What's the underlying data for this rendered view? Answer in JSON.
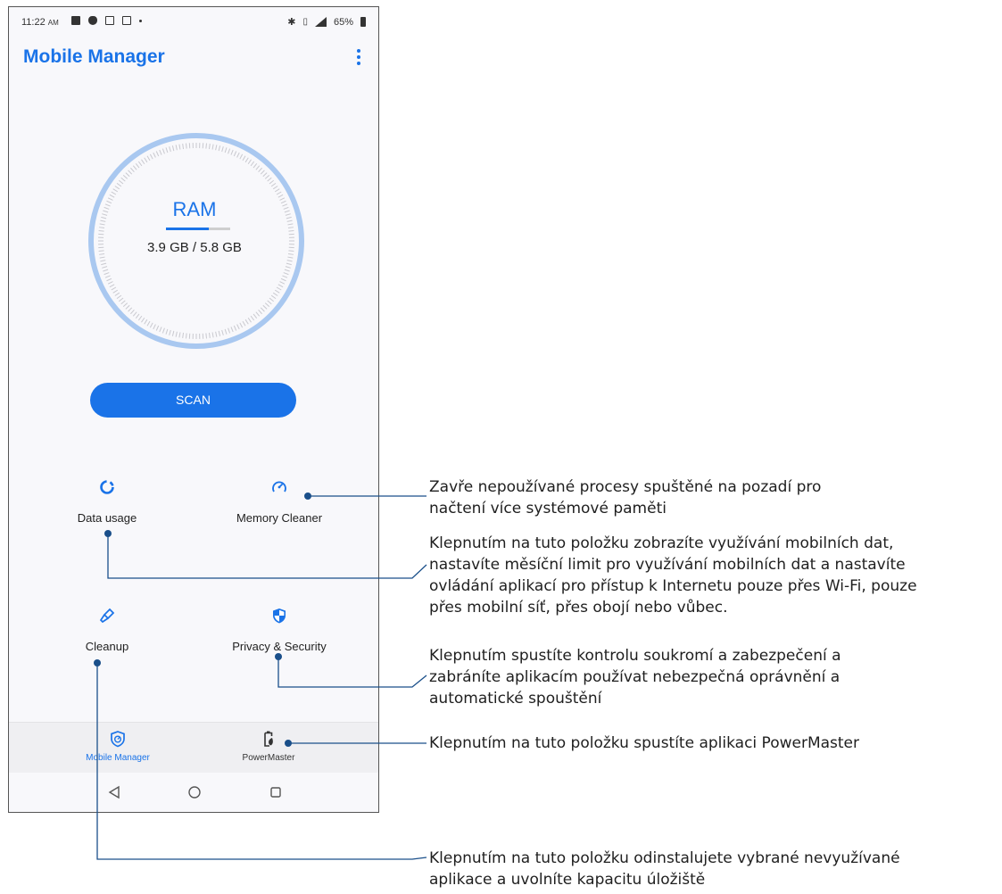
{
  "status_bar": {
    "time": "11:22",
    "am_pm": "AM",
    "battery": "65%",
    "icons_left": [
      "message-icon",
      "shield-icon",
      "image-icon",
      "map-icon",
      "dot-icon"
    ],
    "icons_right": [
      "bluetooth-icon",
      "vibrate-icon",
      "signal-icon",
      "battery-icon"
    ]
  },
  "app": {
    "title": "Mobile Manager",
    "menu_icon": "more-vert-icon"
  },
  "ram": {
    "label": "RAM",
    "value": "3.9 GB / 5.8 GB",
    "usage_fraction": 0.67
  },
  "scan_button": {
    "label": "SCAN"
  },
  "features": [
    {
      "id": "data-usage",
      "label": "Data usage",
      "icon": "data-usage-icon"
    },
    {
      "id": "memory-cleaner",
      "label": "Memory Cleaner",
      "icon": "speedometer-icon"
    },
    {
      "id": "cleanup",
      "label": "Cleanup",
      "icon": "broom-icon"
    },
    {
      "id": "privacy-security",
      "label": "Privacy & Security",
      "icon": "shield-check-icon"
    }
  ],
  "bottom_nav": [
    {
      "label": "Mobile Manager",
      "icon": "mobile-manager-icon",
      "active": true
    },
    {
      "label": "PowerMaster",
      "icon": "battery-leaf-icon",
      "active": false
    }
  ],
  "system_nav": [
    "back-icon",
    "home-icon",
    "recents-icon"
  ],
  "callouts": {
    "memory_cleaner": [
      "Zavře nepoužívané procesy spuštěné na pozadí pro",
      "načtení více systémové paměti"
    ],
    "data_usage": [
      "Klepnutím na tuto položku zobrazíte využívání mobilních dat,",
      "nastavíte měsíční limit pro využívání mobilních dat a nastavíte",
      "ovládání aplikací pro přístup k Internetu pouze přes Wi-Fi, pouze",
      "přes mobilní síť, přes obojí nebo vůbec."
    ],
    "privacy": [
      "Klepnutím spustíte kontrolu soukromí a zabezpečení a",
      "zabráníte aplikacím používat nebezpečná oprávnění a",
      "automatické spouštění"
    ],
    "powermaster": [
      "Klepnutím na tuto položku spustíte aplikaci PowerMaster"
    ],
    "cleanup": [
      "Klepnutím na tuto položku odinstalujete vybrané nevyužívané",
      "aplikace a uvolníte kapacitu úložiště"
    ]
  },
  "colors": {
    "accent": "#1a73e8",
    "gauge_ring": "#a9c8f0",
    "callout_line": "#1a4f8a"
  }
}
